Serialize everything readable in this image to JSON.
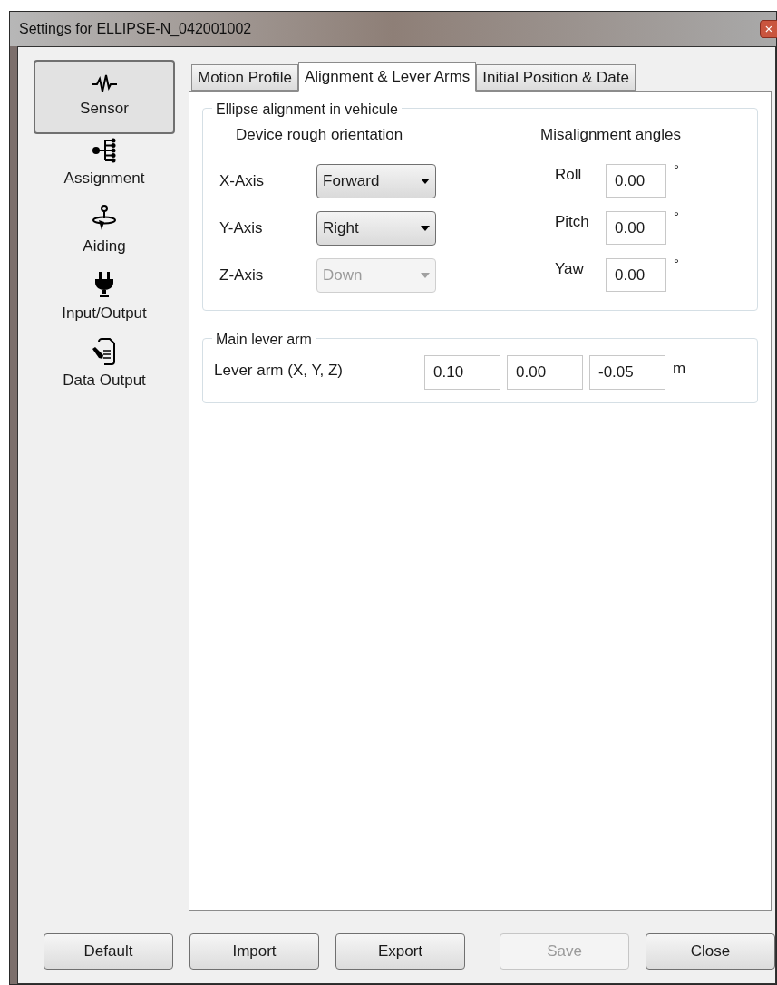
{
  "window": {
    "title": "Settings for ELLIPSE-N_042001002",
    "close": "×"
  },
  "sidebar": {
    "items": [
      {
        "label": "Sensor",
        "selected": true
      },
      {
        "label": "Assignment",
        "selected": false
      },
      {
        "label": "Aiding",
        "selected": false
      },
      {
        "label": "Input/Output",
        "selected": false
      },
      {
        "label": "Data Output",
        "selected": false
      }
    ]
  },
  "tabs": [
    {
      "label": "Motion Profile",
      "selected": false
    },
    {
      "label": "Alignment & Lever Arms",
      "selected": true
    },
    {
      "label": "Initial Position & Date",
      "selected": false
    }
  ],
  "alignment": {
    "title": "Ellipse alignment in vehicule",
    "orientation_heading": "Device rough orientation",
    "angles_heading": "Misalignment angles",
    "axes": [
      {
        "label": "X-Axis",
        "value": "Forward",
        "disabled": false
      },
      {
        "label": "Y-Axis",
        "value": "Right",
        "disabled": false
      },
      {
        "label": "Z-Axis",
        "value": "Down",
        "disabled": true
      }
    ],
    "angles": [
      {
        "label": "Roll",
        "value": "0.00",
        "unit": "°"
      },
      {
        "label": "Pitch",
        "value": "0.00",
        "unit": "°"
      },
      {
        "label": "Yaw",
        "value": "0.00",
        "unit": "°"
      }
    ]
  },
  "lever_arm": {
    "title": "Main lever arm",
    "label": "Lever arm (X, Y, Z)",
    "values": [
      "0.10",
      "0.00",
      "-0.05"
    ],
    "unit": "m"
  },
  "buttons": [
    {
      "label": "Default",
      "disabled": false
    },
    {
      "label": "Import",
      "disabled": false
    },
    {
      "label": "Export",
      "disabled": false
    },
    {
      "label": "Save",
      "disabled": true
    },
    {
      "label": "Close",
      "disabled": false
    }
  ]
}
